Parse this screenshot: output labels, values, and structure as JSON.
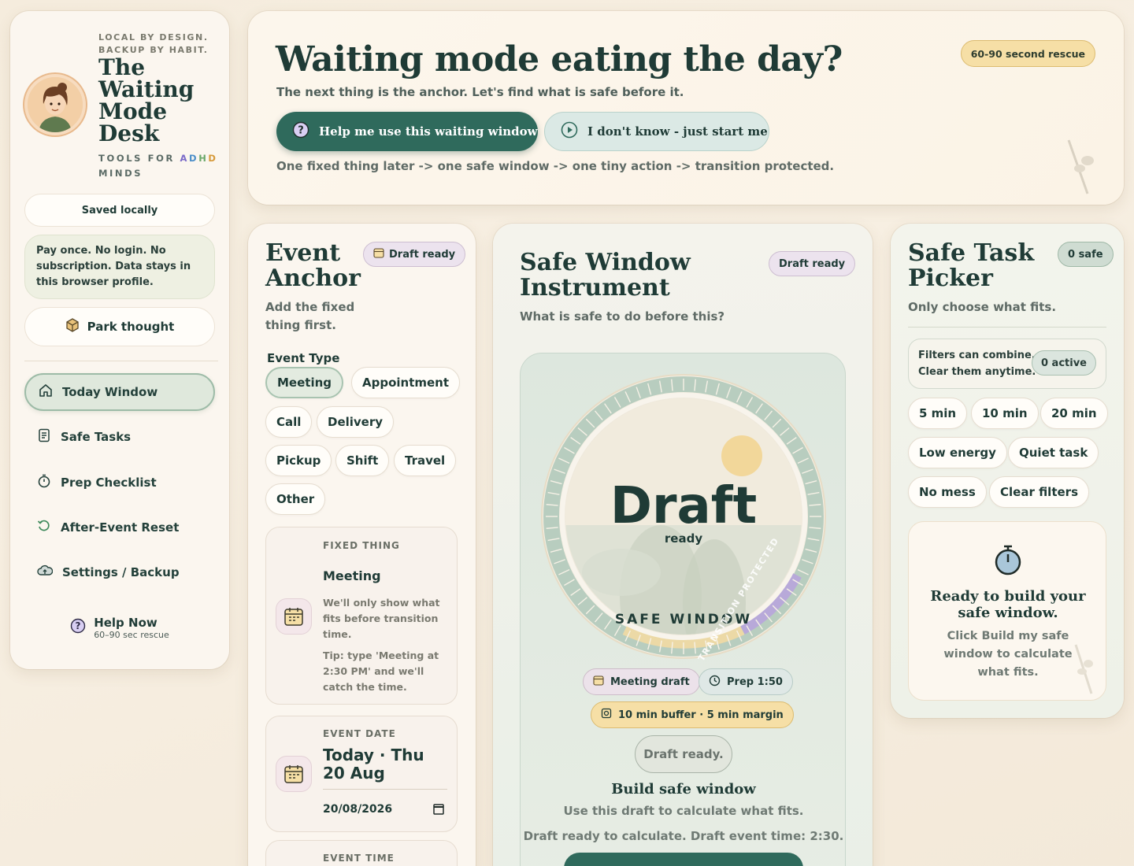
{
  "sidebar": {
    "tagline": "LOCAL BY DESIGN. BACKUP BY HABIT.",
    "title": "The Waiting Mode Desk",
    "subtitle_prefix": "TOOLS FOR ",
    "subtitle_a": "A",
    "subtitle_d": "D",
    "subtitle_h": "H",
    "subtitle_d2": "D",
    "subtitle_suffix": "MINDS",
    "saved_status": "Saved locally",
    "privacy_note": "Pay once. No login. No subscription. Data stays in this browser profile.",
    "park_thought_label": "Park thought",
    "nav": [
      {
        "label": "Today Window",
        "icon": "home-icon",
        "active": true
      },
      {
        "label": "Safe Tasks",
        "icon": "list-icon"
      },
      {
        "label": "Prep Checklist",
        "icon": "stopwatch-icon"
      },
      {
        "label": "After-Event Reset",
        "icon": "reset-icon"
      },
      {
        "label": "Settings / Backup",
        "icon": "cloud-icon"
      }
    ],
    "help_now": {
      "title": "Help Now",
      "subtitle": "60–90 sec rescue"
    }
  },
  "hero": {
    "title": "Waiting mode eating the day?",
    "subtitle": "The next thing is the anchor. Let's find what is safe before it.",
    "badge": "60-90 second rescue",
    "primary_button": "Help me use this waiting window",
    "secondary_button": "I don't know - just start me",
    "flow": "One fixed thing later -> one safe window -> one tiny action -> transition protected."
  },
  "event_anchor": {
    "title_line1": "Event",
    "title_line2": "Anchor",
    "badge": "Draft ready",
    "subtitle_line1": "Add the fixed",
    "subtitle_line2": "thing first.",
    "event_type_label": "Event Type",
    "event_types": [
      "Meeting",
      "Appointment",
      "Call",
      "Delivery",
      "Pickup",
      "Shift",
      "Travel",
      "Other"
    ],
    "selected_type": "Meeting",
    "fixed_thing": {
      "label": "FIXED THING",
      "value": "Meeting",
      "help": "We'll only show what fits before transition time.",
      "tip": "Tip: type 'Meeting at 2:30 PM' and we'll catch the time."
    },
    "event_date": {
      "label": "EVENT DATE",
      "display_line1": "Today · Thu",
      "display_line2": "20 Aug",
      "input_value": "20/08/2026"
    },
    "event_time": {
      "label": "EVENT TIME"
    }
  },
  "safe_window": {
    "title_line1": "Safe Window",
    "title_line2": "Instrument",
    "badge": "Draft ready",
    "subtitle": "What is safe to do before this?",
    "dial": {
      "big_text": "Draft",
      "small_text": "ready",
      "ring_label": "SAFE WINDOW",
      "arc_label": "TRANSITION PROTECTED"
    },
    "meeting_badge": "Meeting draft",
    "prep_badge": "Prep 1:50",
    "buffer_badge": "10 min buffer · 5 min margin",
    "draft_button": "Draft ready.",
    "build_title": "Build safe window",
    "build_sub": "Use this draft to calculate what fits.",
    "status_line": "Draft ready to calculate. Draft event time: 2:30."
  },
  "safe_picker": {
    "title_line1": "Safe Task",
    "title_line2": "Picker",
    "badge": "0 safe",
    "subtitle": "Only choose what fits.",
    "filters_note_line1": "Filters can combine.",
    "filters_note_line2": "Clear them anytime.",
    "filters_active": "0 active",
    "filters": [
      "5 min",
      "10 min",
      "20 min",
      "Low energy",
      "Quiet task",
      "No mess",
      "Clear filters"
    ],
    "ready_title": "Ready to build your safe window.",
    "ready_text": "Click Build my safe window to calculate what fits."
  },
  "colors": {
    "accent": "#2f6a5c",
    "ink": "#1f3b36",
    "amber": "#f6dfa6",
    "sage": "#dfe8dc"
  }
}
